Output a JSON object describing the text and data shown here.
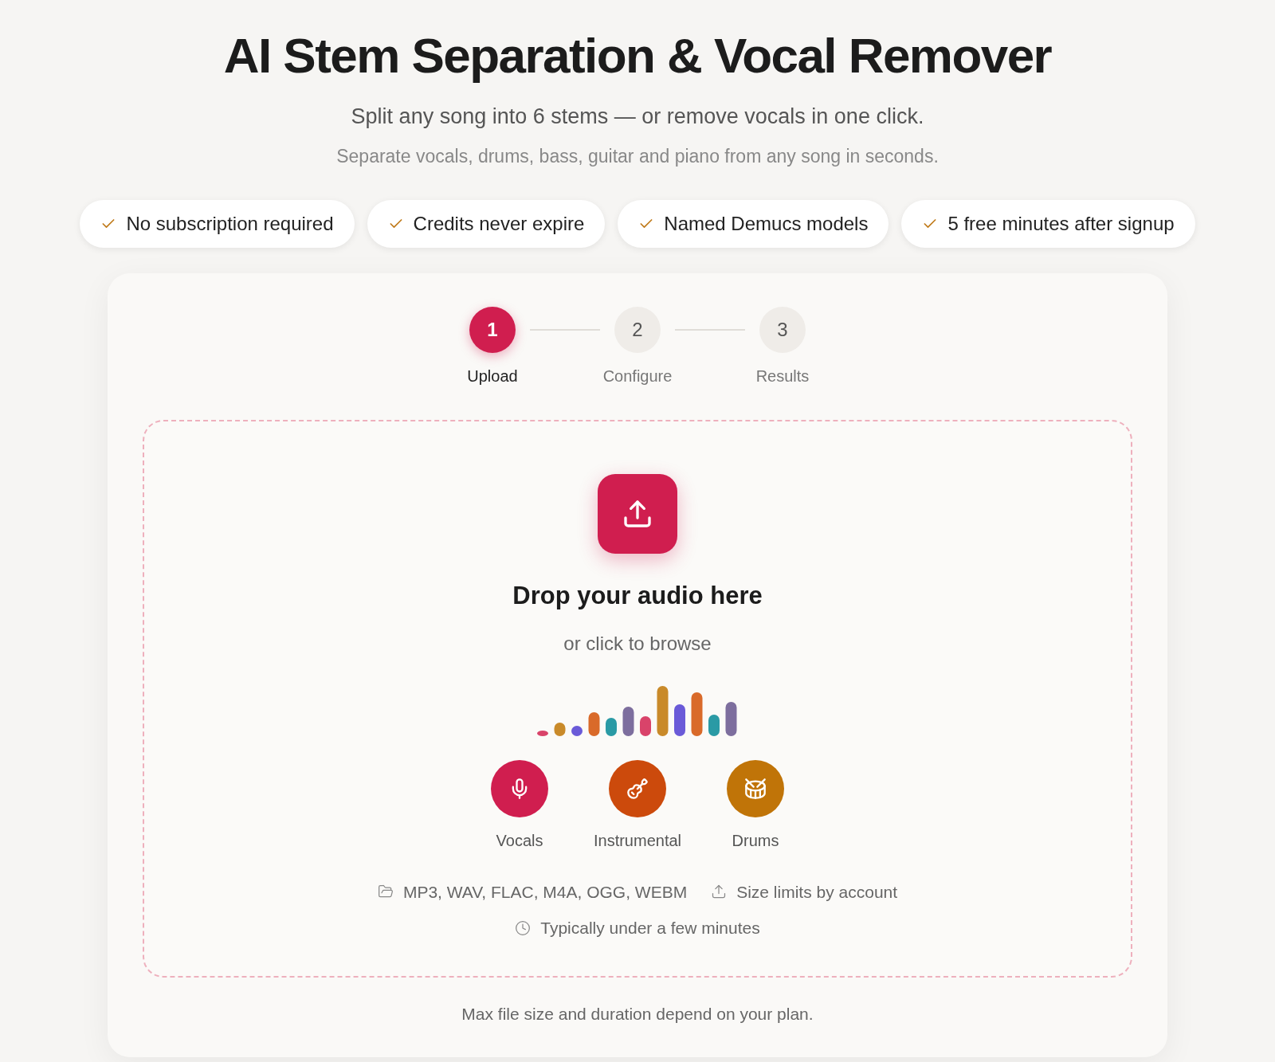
{
  "header": {
    "title": "AI Stem Separation & Vocal Remover",
    "subtitle": "Split any song into 6 stems — or remove vocals in one click.",
    "tagline": "Separate vocals, drums, bass, guitar and piano from any song in seconds."
  },
  "features": [
    "No subscription required",
    "Credits never expire",
    "Named Demucs models",
    "5 free minutes after signup"
  ],
  "steps": [
    {
      "number": "1",
      "label": "Upload",
      "selected": true
    },
    {
      "number": "2",
      "label": "Configure",
      "selected": false
    },
    {
      "number": "3",
      "label": "Results",
      "selected": false
    }
  ],
  "dropzone": {
    "title": "Drop your audio here",
    "hint": "or click to browse",
    "stems": [
      {
        "kind": "mic",
        "label": "Vocals",
        "color": "#d01e4f"
      },
      {
        "kind": "guitar",
        "label": "Instrumental",
        "color": "#cc4a0c"
      },
      {
        "kind": "drum",
        "label": "Drums",
        "color": "#c07408"
      }
    ],
    "info": [
      {
        "kind": "folder",
        "text": "MP3, WAV, FLAC, M4A, OGG, WEBM"
      },
      {
        "kind": "upload",
        "text": "Size limits by account"
      },
      {
        "kind": "clock",
        "text": "Typically under a few minutes"
      }
    ]
  },
  "footnote": "Max file size and duration depend on your plan."
}
